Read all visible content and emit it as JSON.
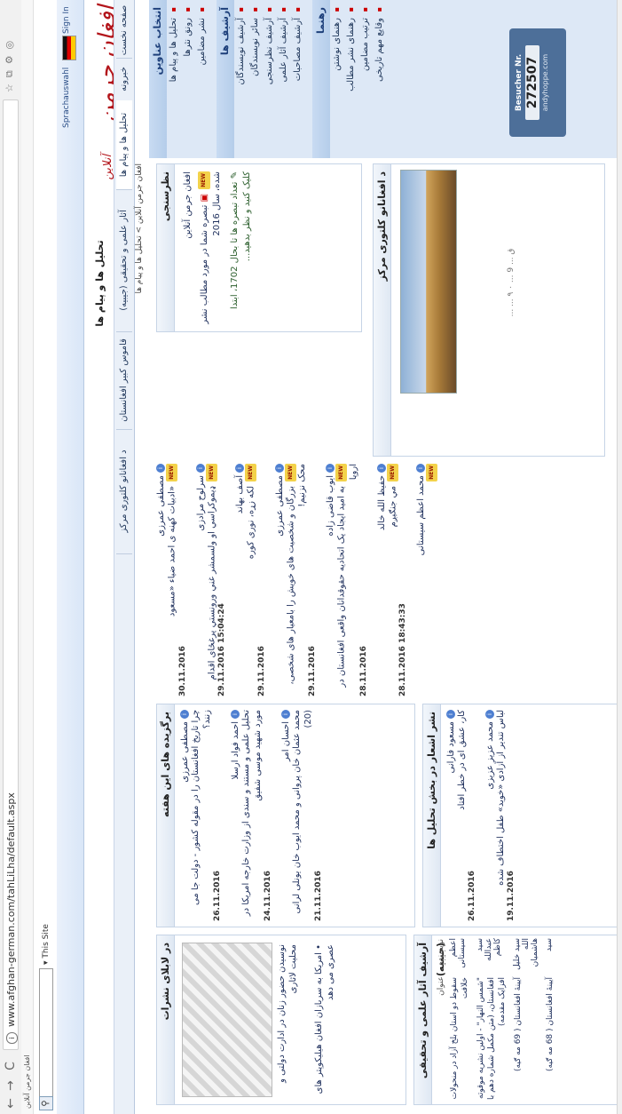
{
  "browser": {
    "back": "←",
    "forward": "→",
    "reload": "C",
    "info": "i",
    "url": "www.afghan-german.com/tahLiLha/default.aspx",
    "bookmark_item": "افغان جرمن آنلاین"
  },
  "search": {
    "button": "⚲",
    "scope": "This Site"
  },
  "top": {
    "sign_in": "Sign In",
    "lang": "Sprachauswahl",
    "page_heading": "تحلیل ها و پیام ها",
    "breadcrumb": "افغان جرمن آنلاین > تحلیل ها و پیام ها",
    "logo": "افغان جرمن",
    "logo_sub": "آنلاین"
  },
  "tabs": [
    "صفحه نخست",
    "خبرونه",
    "تحلیل ها و پیام ها",
    "آثار علمی و تحقیقی (جیبیه)",
    "قاموس کبیر افغانستان",
    "د افغانانو کلتوری مرکز"
  ],
  "sidebar": {
    "sections": [
      {
        "heading": "انتخاب عناوین",
        "items": [
          "تحلیل ها و پیام ها",
          "رونق نثرها",
          "نشر مضامین"
        ]
      },
      {
        "heading": "آرشیف ها",
        "items": [
          "آرشیف نویسندگان",
          "سائر نویسندگان",
          "آرشیف نظرسنجی",
          "آرشیف آثار علمی",
          "آرشیف مصاحبات"
        ]
      },
      {
        "heading": "رهنما",
        "items": [
          "رهنمای نوشتن",
          "رهنمای نشر مطالب",
          "ترتیب مضامین",
          "وقایع مهم تاریخی"
        ]
      }
    ],
    "counter_label": "Besucher Nr.",
    "counter_value": "272507",
    "counter_site": "andyhoppe.com"
  },
  "poll": {
    "heading": "نظرسنجی",
    "source": "افغان جرمن آنلاین",
    "question": "تبصره شما در مورد مطالب نشر شده، سال 2016",
    "result": "تعداد تبصره ها تا بحال 1702، ابتدا کلیک کنید و",
    "more": "نظر بدهید..."
  },
  "culture": {
    "heading": "د افغانانو کلتوری مرکز",
    "caption": "ق ... 9 ... ٠ ٩ ... ..."
  },
  "latest": {
    "entries": [
      {
        "author": "مصطفی عمرزی",
        "title": "«ادبیات کهنه ی احمد ضیاء «مسعود",
        "date": "30.11.2016"
      },
      {
        "author": "سرلوح مرادزی",
        "title": "ډیموکراسي او ولسمشر غني ورونستي پرغځای اقدام",
        "date": "15:04:24 29.11.2016"
      },
      {
        "author": "آصف بهاند",
        "title": "لکه زړه، نوری کوره",
        "date": "29.11.2016"
      },
      {
        "author": "مصطفی عمرزی",
        "title": "بزرگان و شخصیت های خویش را بامعیار های شخصی، محک نزنیم!",
        "date": "29.11.2016"
      },
      {
        "author": "ایوب قاضی زاده",
        "title": "به امید ایجاد یک اتحادیه حقوقدانان واقعی افغانستان در اروپا",
        "date": "28.11.2016"
      },
      {
        "author": "حفیظ الله خالد",
        "title": "مي جنګيږم",
        "date": "18:43:33 28.11.2016"
      },
      {
        "author": "محمد اعظم سیستانی",
        "title": "",
        "date": ""
      }
    ]
  },
  "featured": {
    "heading": "برگزیده های این هفته",
    "entries": [
      {
        "author": "مصطفی عمرزی",
        "title": "چرا تاریخ افغانستان را در مقوله کشور - دولت جا می زنند؟",
        "date": "26.11.2016"
      },
      {
        "author": "احمد فواد ارسلا",
        "title": "تحلیل علمی و مستند و سندی از وزارت خارجه امریکا در مورد شهید موسی شفیق",
        "date": "24.11.2016"
      },
      {
        "author": "احسان امر",
        "title": "محمد عثمان خان پروانی و محمد ایوب خان یونلی لرانی (20)",
        "date": "21.11.2016"
      }
    ]
  },
  "poems": {
    "heading": "نشر اشعار در بخش تحلیل ها",
    "entries": [
      {
        "author": "مسعود فارانی",
        "title": "کار، عشق ای در خطر افتاد",
        "date": "26.11.2016"
      },
      {
        "author": "محمد عزیز عزیزی",
        "title": "لباس تندیر از آزادی «خوید» طفل اختطاف شده",
        "date": "19.11.2016"
      }
    ]
  },
  "press": {
    "heading": "در لابلای نشرات",
    "caption": "نوسیدن حضور زنان در ادارت دولتی و محلیت لاثاری",
    "item": "امریکا به سربازان افغان هیلیکوپتر های عصری می دهد"
  },
  "archive": {
    "heading": "آرشیف آثار علمی و تحقیقی (جیبیه)",
    "col_author": "نویسنده",
    "col_title": "عنوان",
    "rows": [
      {
        "author": "اعظم سیستانی",
        "title": "سقوط دو استان بلخ آزاد در منحولات خلافت"
      },
      {
        "author": "سید عبدالله کاظم",
        "title": "\"شمس النهار\" - اولین نشریه موقوته افغانستان، (متن مکمل شماره دهم با افزایک مقدمه)"
      },
      {
        "author": "سید خلیل الله هاشمیان",
        "title": "آیینۀ افغانستان ( 69 مه ګیه)"
      },
      {
        "author": "سید",
        "title": "آیینۀ افغانستان ( 68 مه ګیه)"
      }
    ]
  },
  "colors": {
    "link": "#1e2f5c",
    "accent": "#b3151b",
    "side_bg": "#dde8f6"
  }
}
